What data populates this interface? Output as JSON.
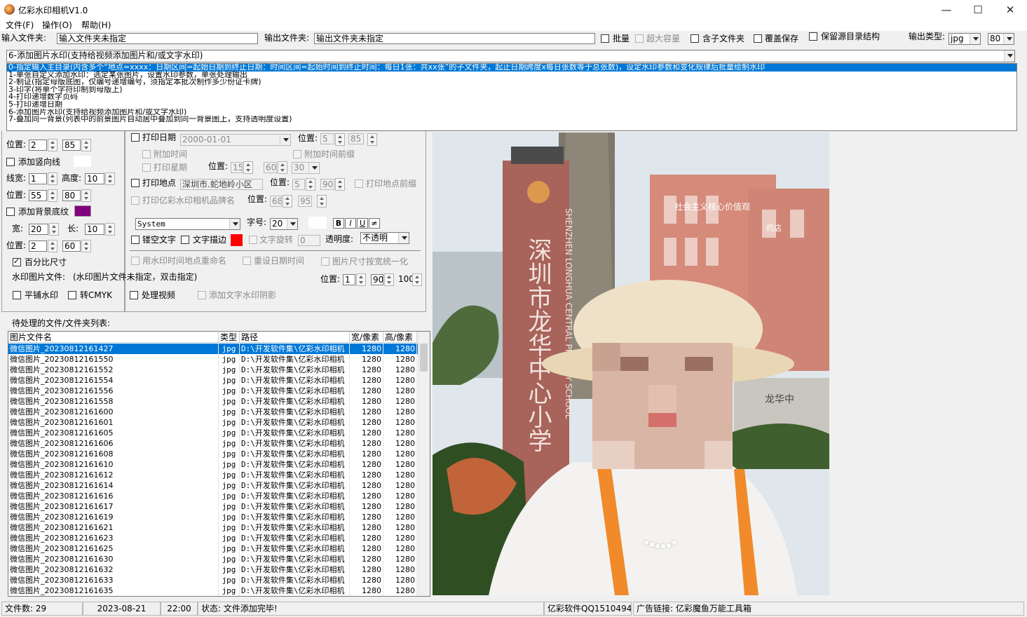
{
  "window": {
    "title": "亿彩水印相机V1.0",
    "min_icon": "minimize-icon",
    "max_icon": "maximize-icon",
    "close_icon": "close-icon"
  },
  "menu": [
    "文件(F)",
    "操作(O)",
    "帮助(H)"
  ],
  "top": {
    "input_label": "输入文件夹:",
    "input_value": "输入文件夹未指定",
    "output_label": "输出文件夹:",
    "output_value": "输出文件夹未指定",
    "batch": "批量",
    "big": "超大容量",
    "subdir": "含子文件夹",
    "overwrite": "覆盖保存",
    "keepdir": "保留源目录结构",
    "type_label": "输出类型:",
    "type_value": "jpg",
    "quality_value": "80"
  },
  "mode": {
    "selected": "6-添加图片水印(支持给视频添加图片和/或文字水印)",
    "options": [
      "0-指定输入主目录(内含多个“地点=xxxx：日期区间=起始日期到终止日期：时间区间=起始时间到终止时间：每日1张：共xx张”的子文件夹，起止日期跨度x每日张数等于总张数)，设定水印参数和变化规律后批量绘制水印",
      "1-单张自定义添加水印：选定某张图片，设置水印参数，单张处理输出",
      "2-制证(指定母版底图，仅编号递增编号，须指定本批次制作多少份证卡牌)",
      "3-印字(将单个字符印制到母版上)",
      "4-打印递增数字页码",
      "5-打印递增日期",
      "6-添加图片水印(支持给视频添加图片和/或文字水印)",
      "7-叠加同一背景(列表中的前景图片自动居中叠加到同一背景图上，支持透明度设置)"
    ]
  },
  "left": {
    "pos_label": "位置:",
    "pos1_a": "2",
    "pos1_b": "85",
    "vline": "添加竖向线",
    "width_label": "线宽:",
    "width_val": "1",
    "height_label": "高度:",
    "height_val": "10",
    "pos2_a": "55",
    "pos2_b": "80",
    "bg": "添加背景底纹",
    "bg_color": "#800080",
    "w_label": "宽:",
    "w_val": "20",
    "l_label": "长:",
    "l_val": "10",
    "pos3_a": "2",
    "pos3_b": "60",
    "percent": "百分比尺寸",
    "wm_file_label": "水印图片文件:",
    "wm_file_value": "(水印图片文件未指定，双击指定)",
    "tile": "平铺水印",
    "cmyk": "转CMYK",
    "video": "处理视频",
    "shadow": "添加文字水印阴影"
  },
  "mid": {
    "print_date": "打印日期",
    "date_val": "2000-01-01",
    "pos_label": "位置:",
    "date_pos_a": "5",
    "date_pos_b": "85",
    "add_time": "附加时间",
    "add_time_prefix": "附加时间前缀",
    "print_week": "打印星期",
    "week_pos_a": "15",
    "week_pos_b": "60",
    "week_pos_c": "30",
    "print_place": "打印地点",
    "place_val": "深圳市.蛇地岭小区",
    "place_pos_a": "5",
    "place_pos_b": "90",
    "place_prefix": "打印地点前缀",
    "print_brand": "打印亿彩水印相机品牌名",
    "brand_pos_a": "68",
    "brand_pos_b": "95",
    "font": "System",
    "size_label": "字号:",
    "size_val": "20",
    "fmt_b": "B",
    "fmt_i": "I",
    "fmt_u": "U",
    "fmt_s": "≠",
    "hollow": "镂空文字",
    "outline": "文字描边",
    "outline_color": "#ff0000",
    "rotate": "文字旋转",
    "rotate_val": "0",
    "opacity_label": "透明度:",
    "opacity_val": "不透明",
    "rename": "用水印时间地点重命名",
    "reset_date": "重设日期时间",
    "normalize": "图片尺寸按宽统一化",
    "wm_pos_a": "1",
    "wm_pos_b": "90",
    "wm_pos_c": "100"
  },
  "list": {
    "title": "待处理的文件/文件夹列表:",
    "headers": [
      "图片文件名",
      "类型",
      "路径",
      "宽/像素",
      "高/像素"
    ],
    "rows": [
      [
        "微信图片_20230812161427",
        "jpg",
        "D:\\开发软件集\\亿彩水印相机",
        "1280",
        "1280"
      ],
      [
        "微信图片_20230812161550",
        "jpg",
        "D:\\开发软件集\\亿彩水印相机",
        "1280",
        "1280"
      ],
      [
        "微信图片_20230812161552",
        "jpg",
        "D:\\开发软件集\\亿彩水印相机",
        "1280",
        "1280"
      ],
      [
        "微信图片_20230812161554",
        "jpg",
        "D:\\开发软件集\\亿彩水印相机",
        "1280",
        "1280"
      ],
      [
        "微信图片_20230812161556",
        "jpg",
        "D:\\开发软件集\\亿彩水印相机",
        "1280",
        "1280"
      ],
      [
        "微信图片_20230812161558",
        "jpg",
        "D:\\开发软件集\\亿彩水印相机",
        "1280",
        "1280"
      ],
      [
        "微信图片_20230812161600",
        "jpg",
        "D:\\开发软件集\\亿彩水印相机",
        "1280",
        "1280"
      ],
      [
        "微信图片_20230812161601",
        "jpg",
        "D:\\开发软件集\\亿彩水印相机",
        "1280",
        "1280"
      ],
      [
        "微信图片_20230812161605",
        "jpg",
        "D:\\开发软件集\\亿彩水印相机",
        "1280",
        "1280"
      ],
      [
        "微信图片_20230812161606",
        "jpg",
        "D:\\开发软件集\\亿彩水印相机",
        "1280",
        "1280"
      ],
      [
        "微信图片_20230812161608",
        "jpg",
        "D:\\开发软件集\\亿彩水印相机",
        "1280",
        "1280"
      ],
      [
        "微信图片_20230812161610",
        "jpg",
        "D:\\开发软件集\\亿彩水印相机",
        "1280",
        "1280"
      ],
      [
        "微信图片_20230812161612",
        "jpg",
        "D:\\开发软件集\\亿彩水印相机",
        "1280",
        "1280"
      ],
      [
        "微信图片_20230812161614",
        "jpg",
        "D:\\开发软件集\\亿彩水印相机",
        "1280",
        "1280"
      ],
      [
        "微信图片_20230812161616",
        "jpg",
        "D:\\开发软件集\\亿彩水印相机",
        "1280",
        "1280"
      ],
      [
        "微信图片_20230812161617",
        "jpg",
        "D:\\开发软件集\\亿彩水印相机",
        "1280",
        "1280"
      ],
      [
        "微信图片_20230812161619",
        "jpg",
        "D:\\开发软件集\\亿彩水印相机",
        "1280",
        "1280"
      ],
      [
        "微信图片_20230812161621",
        "jpg",
        "D:\\开发软件集\\亿彩水印相机",
        "1280",
        "1280"
      ],
      [
        "微信图片_20230812161623",
        "jpg",
        "D:\\开发软件集\\亿彩水印相机",
        "1280",
        "1280"
      ],
      [
        "微信图片_20230812161625",
        "jpg",
        "D:\\开发软件集\\亿彩水印相机",
        "1280",
        "1280"
      ],
      [
        "微信图片_20230812161630",
        "jpg",
        "D:\\开发软件集\\亿彩水印相机",
        "1280",
        "1280"
      ],
      [
        "微信图片_20230812161632",
        "jpg",
        "D:\\开发软件集\\亿彩水印相机",
        "1280",
        "1280"
      ],
      [
        "微信图片_20230812161633",
        "jpg",
        "D:\\开发软件集\\亿彩水印相机",
        "1280",
        "1280"
      ],
      [
        "微信图片_20230812161635",
        "jpg",
        "D:\\开发软件集\\亿彩水印相机",
        "1280",
        "1280"
      ]
    ]
  },
  "status": {
    "count": "文件数: 29",
    "date": "2023-08-21",
    "time": "22:00",
    "state": "状态: 文件添加完毕!",
    "qq": "亿彩软件QQ15104946.",
    "ad": "广告链接: 亿彩魔鱼万能工具箱"
  },
  "preview": {
    "sign_text": "深圳市龙华中心小学",
    "sign_text_en": "SHENZHEN LONGHUA CENTRAL PRIMARY SCHOOL",
    "rooftop_sign": "社会主义核心价值观",
    "building_sign": "药店",
    "wall_sign": "龙华中"
  }
}
